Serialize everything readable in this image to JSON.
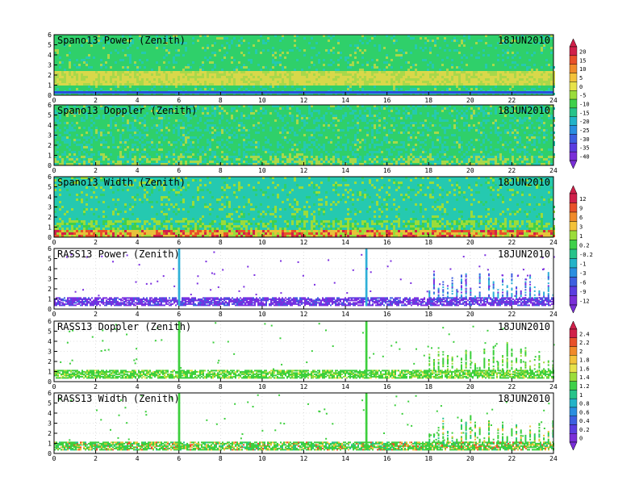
{
  "chart_data": [
    {
      "type": "heatmap",
      "title": "Spano13 Power (Zenith)",
      "date": "18JUN2010",
      "xlim": [
        0,
        24
      ],
      "ylim": [
        0,
        6
      ],
      "x_ticks": [
        "0",
        "2",
        "4",
        "6",
        "8",
        "10",
        "12",
        "14",
        "16",
        "18",
        "20",
        "22",
        "24"
      ],
      "y_ticks": [
        "0",
        "1",
        "2",
        "3",
        "4",
        "5",
        "6"
      ],
      "pattern": "dense",
      "base_color": "#2fd06a",
      "colorbar": "power"
    },
    {
      "type": "heatmap",
      "title": "Spano13 Doppler (Zenith)",
      "date": "18JUN2010",
      "xlim": [
        0,
        24
      ],
      "ylim": [
        0,
        6
      ],
      "x_ticks": [
        "0",
        "2",
        "4",
        "6",
        "8",
        "10",
        "12",
        "14",
        "16",
        "18",
        "20",
        "22",
        "24"
      ],
      "y_ticks": [
        "0",
        "1",
        "2",
        "3",
        "4",
        "5",
        "6"
      ],
      "pattern": "dense",
      "base_color": "#2fd06a",
      "colorbar": null
    },
    {
      "type": "heatmap",
      "title": "Spano13 Width (Zenith)",
      "date": "18JUN2010",
      "xlim": [
        0,
        24
      ],
      "ylim": [
        0,
        6
      ],
      "x_ticks": [
        "0",
        "2",
        "4",
        "6",
        "8",
        "10",
        "12",
        "14",
        "16",
        "18",
        "20",
        "22",
        "24"
      ],
      "y_ticks": [
        "0",
        "1",
        "2",
        "3",
        "4",
        "5",
        "6"
      ],
      "pattern": "dense",
      "base_color": "#25c9b0",
      "colorbar": "width"
    },
    {
      "type": "heatmap",
      "title": "RASS13 Power (Zenith)",
      "date": "18JUN2010",
      "xlim": [
        0,
        24
      ],
      "ylim": [
        0,
        6
      ],
      "x_ticks": [
        "0",
        "2",
        "4",
        "6",
        "8",
        "10",
        "12",
        "14",
        "16",
        "18",
        "20",
        "22",
        "24"
      ],
      "y_ticks": [
        "0",
        "1",
        "2",
        "3",
        "4",
        "5",
        "6"
      ],
      "pattern": "sparse",
      "base_color": "#7b2fe0",
      "colorbar": "rass_power"
    },
    {
      "type": "heatmap",
      "title": "RASS13 Doppler (Zenith)",
      "date": "18JUN2010",
      "xlim": [
        0,
        24
      ],
      "ylim": [
        0,
        6
      ],
      "x_ticks": [
        "0",
        "2",
        "4",
        "6",
        "8",
        "10",
        "12",
        "14",
        "16",
        "18",
        "20",
        "22",
        "24"
      ],
      "y_ticks": [
        "0",
        "1",
        "2",
        "3",
        "4",
        "5",
        "6"
      ],
      "pattern": "sparse",
      "base_color": "#3ccf3c",
      "colorbar": null
    },
    {
      "type": "heatmap",
      "title": "RASS13 Width (Zenith)",
      "date": "18JUN2010",
      "xlim": [
        0,
        24
      ],
      "ylim": [
        0,
        6
      ],
      "x_ticks": [
        "0",
        "2",
        "4",
        "6",
        "8",
        "10",
        "12",
        "14",
        "16",
        "18",
        "20",
        "22",
        "24"
      ],
      "y_ticks": [
        "0",
        "1",
        "2",
        "3",
        "4",
        "5",
        "6"
      ],
      "pattern": "sparse",
      "base_color": "#3ccf3c",
      "colorbar": "rass_width"
    }
  ],
  "colorbars": {
    "power": {
      "labels": [
        "20",
        "15",
        "10",
        "5",
        "0",
        "-5",
        "-10",
        "-15",
        "-20",
        "-25",
        "-30",
        "-35",
        "-40"
      ],
      "colors": [
        "#d0204a",
        "#e8502a",
        "#f08a2a",
        "#f3c23a",
        "#e7e24a",
        "#9bdc3a",
        "#3fd04a",
        "#27c38a",
        "#23b3c8",
        "#2a8ee0",
        "#3d5fe0",
        "#5a3de0",
        "#7a2fd8"
      ]
    },
    "width": {
      "labels": [
        "12",
        "9",
        "6",
        "3",
        "1",
        "0.2",
        "-0.2",
        "-1",
        "-3",
        "-6",
        "-9",
        "-12"
      ],
      "colors": [
        "#d0204a",
        "#e8502a",
        "#f08a2a",
        "#f3c23a",
        "#9bdc3a",
        "#3fd04a",
        "#27c38a",
        "#23b3c8",
        "#2a8ee0",
        "#3d5fe0",
        "#5a3de0",
        "#7a2fd8"
      ]
    },
    "rass": {
      "labels": [
        "2.4",
        "2.2",
        "2",
        "1.8",
        "1.6",
        "1.4",
        "1.2",
        "1",
        "0.8",
        "0.6",
        "0.4",
        "0.2",
        "0"
      ],
      "colors": [
        "#d0204a",
        "#e8502a",
        "#f08a2a",
        "#f3c23a",
        "#e7e24a",
        "#9bdc3a",
        "#3fd04a",
        "#27c38a",
        "#23b3c8",
        "#2a8ee0",
        "#3d5fe0",
        "#5a3de0",
        "#7a2fd8"
      ]
    }
  }
}
